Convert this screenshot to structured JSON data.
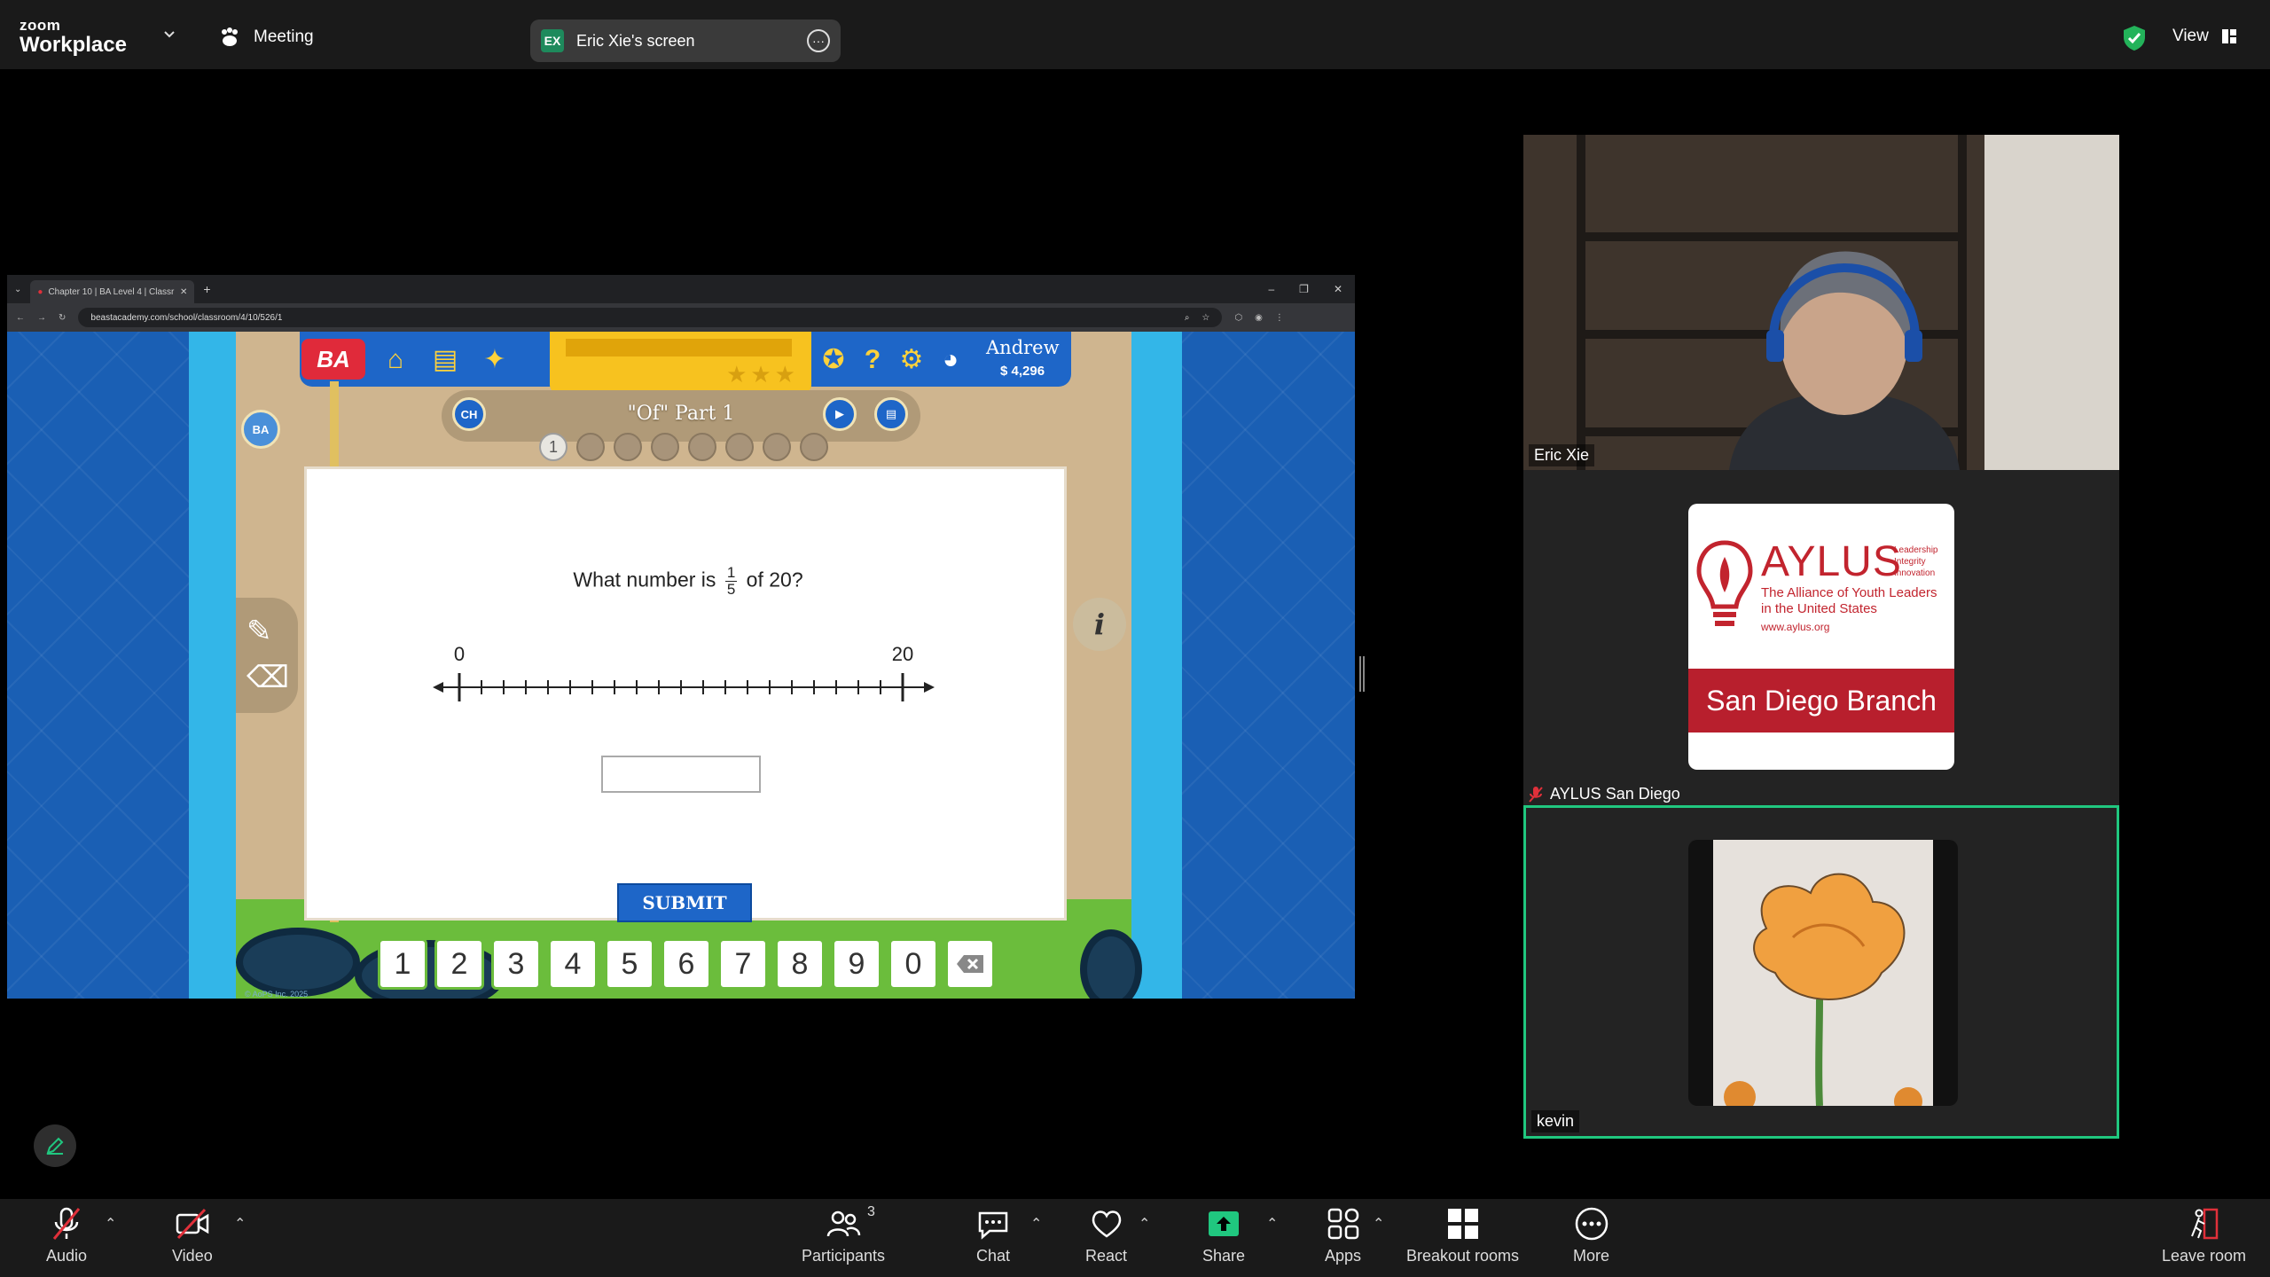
{
  "app": {
    "logo_line1": "zoom",
    "logo_line2": "Workplace",
    "meeting_label": "Meeting",
    "screen_share_initials": "EX",
    "screen_share_label": "Eric Xie's screen",
    "view_label": "View"
  },
  "browser": {
    "tab_title": "Chapter 10 | BA Level 4 | Classr",
    "url": "beastacademy.com/school/classroom/4/10/526/1"
  },
  "game": {
    "logo": "BA",
    "chapter_badge": "CH",
    "user_name": "Andrew",
    "coins": "4,296",
    "lesson_title": "\"Of\" Part 1",
    "current_question": "1",
    "question_prefix": "What number is",
    "fraction_numerator": "1",
    "fraction_denominator": "5",
    "question_suffix": "of 20?",
    "numberline_start": "0",
    "numberline_end": "20",
    "numberline_ticks": 20,
    "submit_label": "SUBMIT",
    "keypad": [
      "1",
      "2",
      "3",
      "4",
      "5",
      "6",
      "7",
      "8",
      "9",
      "0"
    ],
    "info_icon": "i",
    "copyright": "© AoPS Inc. 2025"
  },
  "participants": [
    {
      "name": "Eric Xie"
    },
    {
      "name": "AYLUS San Diego",
      "muted": true
    },
    {
      "name": "kevin",
      "active_speaker": true
    }
  ],
  "aylus": {
    "title": "AYLUS",
    "tags": [
      "Leadership",
      "Integrity",
      "Innovation"
    ],
    "subtitle_1": "The Alliance of Youth Leaders",
    "subtitle_2": "in the United States",
    "url": "www.aylus.org",
    "band": "San Diego Branch"
  },
  "toolbar": {
    "audio": "Audio",
    "video": "Video",
    "participants": "Participants",
    "participants_count": "3",
    "chat": "Chat",
    "react": "React",
    "share": "Share",
    "apps": "Apps",
    "breakout": "Breakout rooms",
    "more": "More",
    "leave": "Leave room"
  },
  "colors": {
    "zoom_share_green": "#20c77f",
    "mute_red": "#e0303a",
    "game_blue": "#1e66c8",
    "aylus_red": "#b81f2d"
  }
}
